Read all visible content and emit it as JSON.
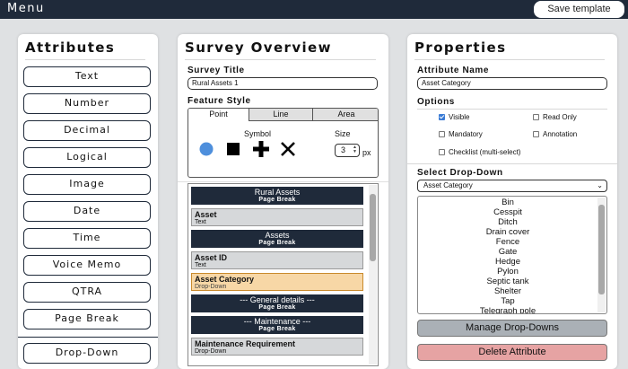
{
  "topbar": {
    "menu_label": "Menu",
    "save_template_label": "Save template"
  },
  "attributes": {
    "title": "Attributes",
    "buttons": [
      "Text",
      "Number",
      "Decimal",
      "Logical",
      "Image",
      "Date",
      "Time",
      "Voice Memo",
      "QTRA",
      "Page Break",
      "Drop-Down"
    ]
  },
  "survey": {
    "title": "Survey Overview",
    "survey_title_label": "Survey Title",
    "survey_title_value": "Rural Assets 1",
    "feature_style_label": "Feature Style",
    "tabs": [
      "Point",
      "Line",
      "Area"
    ],
    "active_tab": "Point",
    "symbol_label": "Symbol",
    "size_label": "Size",
    "size_value": "3",
    "size_unit": "px",
    "symbols": [
      "circle-icon",
      "square-icon",
      "plus-icon",
      "cross-icon"
    ],
    "items": [
      {
        "name": "Rural Assets",
        "type": "Page Break",
        "kind": "page"
      },
      {
        "name": "Asset",
        "type": "Text",
        "kind": "field"
      },
      {
        "name": "Assets",
        "type": "Page Break",
        "kind": "page"
      },
      {
        "name": "Asset ID",
        "type": "Text",
        "kind": "field"
      },
      {
        "name": "Asset Category",
        "type": "Drop-Down",
        "kind": "selected"
      },
      {
        "name": "--- General details ---",
        "type": "Page Break",
        "kind": "page"
      },
      {
        "name": "--- Maintenance ---",
        "type": "Page Break",
        "kind": "page"
      },
      {
        "name": "Maintenance Requirement",
        "type": "Drop-Down",
        "kind": "field"
      }
    ]
  },
  "properties": {
    "title": "Properties",
    "attribute_name_label": "Attribute Name",
    "attribute_name_value": "Asset Category",
    "options_label": "Options",
    "options": [
      {
        "label": "Visible",
        "checked": true
      },
      {
        "label": "Read Only",
        "checked": false
      },
      {
        "label": "Mandatory",
        "checked": false
      },
      {
        "label": "Annotation",
        "checked": false
      },
      {
        "label": "Checklist (multi-select)",
        "checked": false
      }
    ],
    "select_dropdown_label": "Select Drop-Down",
    "select_dropdown_value": "Asset Category",
    "dropdown_options": [
      "Bin",
      "Cesspit",
      "Ditch",
      "Drain cover",
      "Fence",
      "Gate",
      "Hedge",
      "Pylon",
      "Septic tank",
      "Shelter",
      "Tap",
      "Telegraph pole"
    ],
    "manage_label": "Manage Drop-Downs",
    "delete_label": "Delete Attribute"
  },
  "colors": {
    "navy": "#1f2a3a",
    "selected": "#f7d7a6",
    "manage": "#aab0b6",
    "delete": "#e6a3a3",
    "check": "#3a7bd5",
    "circle": "#4e8fdc"
  }
}
